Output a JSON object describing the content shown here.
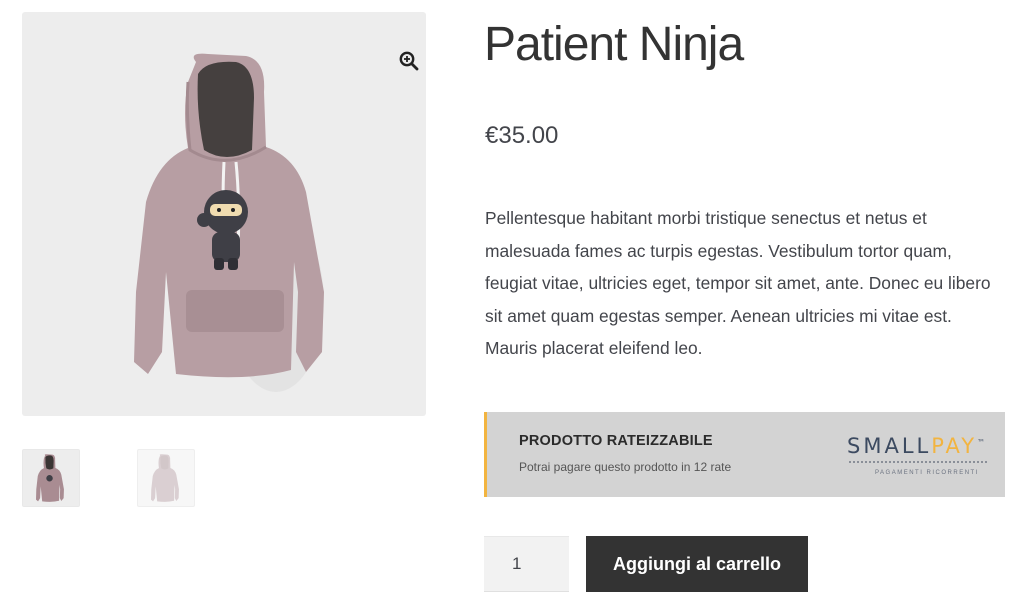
{
  "product": {
    "title": "Patient Ninja",
    "price": "€35.00",
    "description": "Pellentesque habitant morbi tristique senectus et netus et malesuada fames ac turpis egestas. Vestibulum tortor quam, feugiat vitae, ultricies eget, tempor sit amet, ante. Donec eu libero sit amet quam egestas semper. Aenean ultricies mi vitae est. Mauris placerat eleifend leo."
  },
  "gallery": {
    "zoom_icon": "zoom-in-icon",
    "thumbnails": [
      "hoodie-front",
      "hoodie-back"
    ]
  },
  "installments": {
    "title": "PRODOTTO RATEIZZABILE",
    "subtitle": "Potrai pagare questo prodotto in 12 rate",
    "logo_small": "SMALL",
    "logo_pay": "PAY",
    "logo_tm": "™",
    "logo_tagline": "PAGAMENTI RICORRENTI",
    "accent_color": "#f2b440"
  },
  "cart": {
    "quantity": "1",
    "add_label": "Aggiungi al carrello"
  }
}
